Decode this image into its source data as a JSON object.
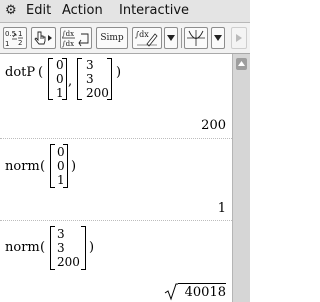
{
  "menu": {
    "gear_icon": "gear-icon",
    "items": [
      "Edit",
      "Action",
      "Interactive"
    ]
  },
  "toolbar": {
    "frac_top": "0.5",
    "frac_bottom": "1",
    "frac_den": "2",
    "simp_label": "Simp",
    "icons": [
      "fraction-decimal-toggle-icon",
      "hand-drag-icon",
      "integral-evaluate-icon",
      "simp-button",
      "dx-pen-icon",
      "dropdown-icon",
      "graph-icon",
      "dropdown-icon",
      "scroll-right-icon"
    ]
  },
  "expressions": [
    {
      "func": "dotP",
      "args": [
        [
          "0",
          "0",
          "1"
        ],
        [
          "3",
          "3",
          "200"
        ]
      ],
      "result": "200"
    },
    {
      "func": "norm",
      "args": [
        [
          "0",
          "0",
          "1"
        ]
      ],
      "result": "1"
    },
    {
      "func": "norm",
      "args": [
        [
          "3",
          "3",
          "200"
        ]
      ],
      "result_sqrt_of": "40018"
    }
  ]
}
